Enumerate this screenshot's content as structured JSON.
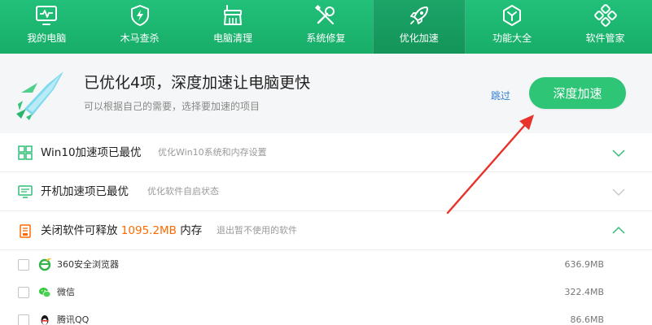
{
  "nav": {
    "items": [
      {
        "label": "我的电脑",
        "icon": "monitor-pulse-icon"
      },
      {
        "label": "木马查杀",
        "icon": "shield-bolt-icon"
      },
      {
        "label": "电脑清理",
        "icon": "broom-icon"
      },
      {
        "label": "系统修复",
        "icon": "wrench-screwdriver-icon"
      },
      {
        "label": "优化加速",
        "icon": "rocket-icon"
      },
      {
        "label": "功能大全",
        "icon": "hexagon-icon"
      },
      {
        "label": "软件管家",
        "icon": "apps-flower-icon"
      }
    ],
    "active_index": 4
  },
  "header": {
    "title": "已优化4项，深度加速让电脑更快",
    "subtitle": "可以根据自己的需要，选择要加速的项目",
    "skip_label": "跳过",
    "action_label": "深度加速"
  },
  "sections": [
    {
      "title": "Win10加速项已最优",
      "desc": "优化Win10系统和内存设置",
      "icon": "windows-grid-icon",
      "state": "collapsed"
    },
    {
      "title": "开机加速项已最优",
      "desc": "优化软件自启状态",
      "icon": "monitor-icon",
      "state": "collapsed"
    },
    {
      "title_prefix": "关闭软件可释放",
      "amount": "1095.2MB",
      "title_suffix": "内存",
      "desc": "退出暂不使用的软件",
      "icon": "memory-chip-icon",
      "state": "expanded"
    }
  ],
  "software": [
    {
      "name": "360安全浏览器",
      "size": "636.9MB",
      "icon": "360-browser-icon",
      "checked": false
    },
    {
      "name": "微信",
      "size": "322.4MB",
      "icon": "wechat-icon",
      "checked": false
    },
    {
      "name": "腾讯QQ",
      "size": "86.6MB",
      "icon": "qq-penguin-icon",
      "checked": false
    }
  ],
  "colors": {
    "brand_green": "#1fb872",
    "button_green": "#2ec577",
    "link_blue": "#2f7fd4",
    "highlight_orange": "#ff6a00",
    "annotation_red": "#e8322b"
  }
}
